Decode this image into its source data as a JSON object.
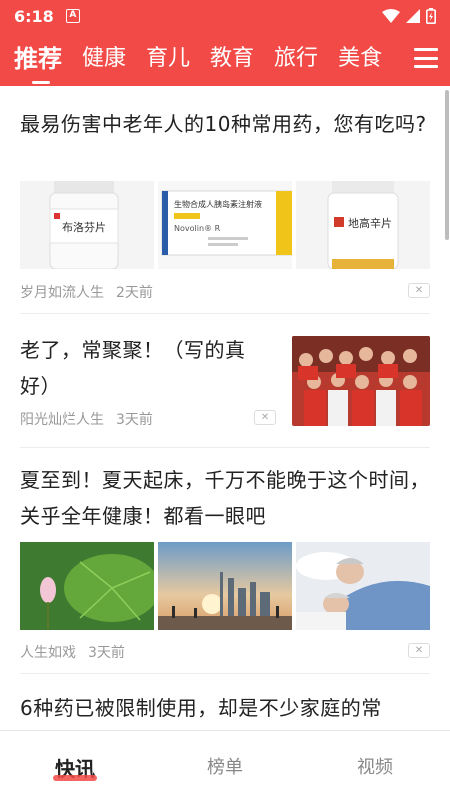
{
  "status": {
    "time": "6:18",
    "notif_glyph": "A"
  },
  "tabs": [
    {
      "label": "推荐",
      "active": true
    },
    {
      "label": "健康"
    },
    {
      "label": "育儿"
    },
    {
      "label": "教育"
    },
    {
      "label": "旅行"
    },
    {
      "label": "美食"
    }
  ],
  "articles": [
    {
      "title": "最易伤害中老年人的10种常用药，您有吃吗?",
      "source": "岁月如流人生",
      "time": "2天前",
      "images": [
        "pill-bottle-bulofenpian",
        "insulin-box-novolin-r",
        "pill-bottle-digaoxinpian"
      ],
      "img_text": {
        "b1": "布洛芬片",
        "box": "生物合成人胰岛素注射液",
        "box_brand": "Novolin® R",
        "b3": "地高辛片"
      }
    },
    {
      "title": "老了，常聚聚！（写的真好）",
      "source": "阳光灿烂人生",
      "time": "3天前",
      "images": [
        "group-photo-elderly"
      ]
    },
    {
      "title": "夏至到！夏天起床，千万不能晚于这个时间，关乎全年健康！都看一眼吧",
      "source": "人生如戏",
      "time": "3天前",
      "images": [
        "lotus-leaf-photo",
        "city-sunset-photo",
        "sleeping-elderly-couple-photo"
      ]
    },
    {
      "title": "6种药已被限制使用，却是不少家庭的常"
    }
  ],
  "dismiss_glyph": "✕",
  "bottom_nav": [
    {
      "label": "快讯",
      "active": true
    },
    {
      "label": "榜单"
    },
    {
      "label": "视频"
    }
  ],
  "colors": {
    "brand": "#f24a46",
    "meta": "#999999"
  }
}
